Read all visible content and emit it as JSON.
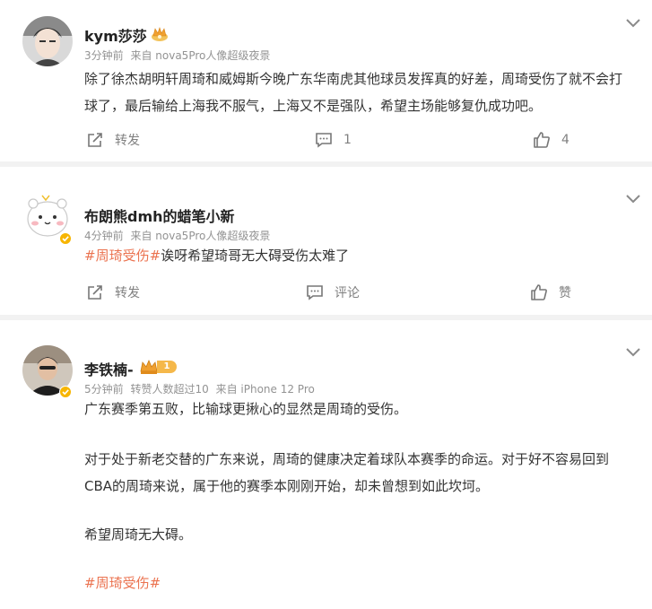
{
  "posts": [
    {
      "user": "kym莎莎",
      "time": "3分钟前",
      "source": "来自 nova5Pro人像超级夜景",
      "text": "除了徐杰胡明轩周琦和威姆斯今晚广东华南虎其他球员发挥真的好差，周琦受伤了就不会打球了，最后输给上海我不服气，上海又不是强队，希望主场能够复仇成功吧。",
      "actions": {
        "repost": "转发",
        "comment": "1",
        "like": "4"
      }
    },
    {
      "user": "布朗熊dmh的蜡笔小新",
      "time": "4分钟前",
      "source": "来自 nova5Pro人像超级夜景",
      "tag": "#周琦受伤#",
      "text": "诶呀希望琦哥无大碍受伤太难了",
      "actions": {
        "repost": "转发",
        "comment": "评论",
        "like": "赞"
      }
    },
    {
      "user": "李铁楠-",
      "time": "5分钟前",
      "repost_info": "转赞人数超过10",
      "source": "来自 iPhone 12 Pro",
      "level": "1",
      "paragraphs": [
        "广东赛季第五败，比输球更揪心的显然是周琦的受伤。",
        "对于处于新老交替的广东来说，周琦的健康决定着球队本赛季的命运。对于好不容易回到CBA的周琦来说，属于他的赛季本刚刚开始，却未曾想到如此坎坷。",
        "希望周琦无大碍。"
      ],
      "tag": "#周琦受伤#"
    }
  ],
  "colors": {
    "tag": "#eb7350",
    "meta": "#939393",
    "gold": "#e8a317"
  }
}
